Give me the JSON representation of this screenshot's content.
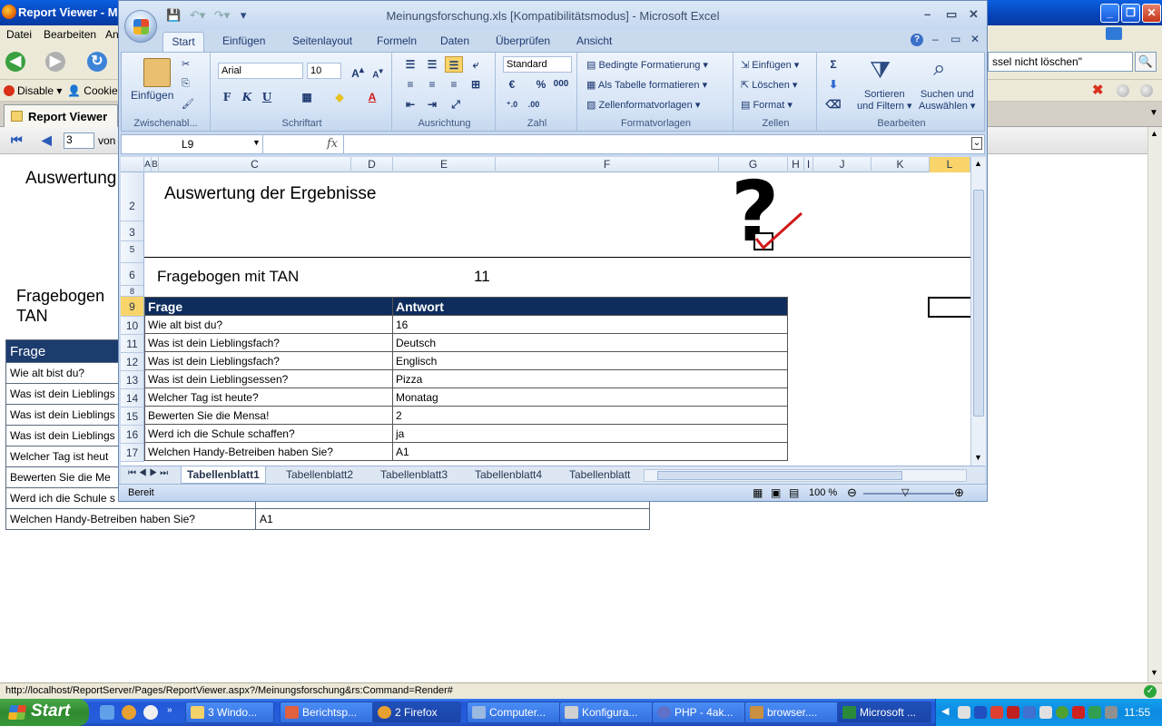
{
  "firefox": {
    "title": "Report Viewer - M",
    "menu": [
      "Datei",
      "Bearbeiten",
      "An"
    ],
    "search_value": "ssel nicht löschen\"",
    "webdev": {
      "disable": "Disable",
      "cookies": "Cookies"
    },
    "tab_label": "Report Viewer",
    "page_number": "3",
    "page_of": "von",
    "status_url": "http://localhost/ReportServer/Pages/ReportViewer.aspx?/Meinungsforschung&rs:Command=Render#"
  },
  "report": {
    "title": "Auswertung",
    "subtitle_line1": "Fragebogen ",
    "subtitle_line2": "TAN",
    "header": "Frage",
    "rows": [
      {
        "q": "Wie alt bist du?",
        "a": ""
      },
      {
        "q": "Was ist dein Lieblings",
        "a": ""
      },
      {
        "q": "Was ist dein Lieblings",
        "a": ""
      },
      {
        "q": "Was ist dein Lieblings",
        "a": ""
      },
      {
        "q": "Welcher Tag ist heut",
        "a": ""
      },
      {
        "q": "Bewerten Sie die Me",
        "a": ""
      },
      {
        "q": "Werd ich die Schule s",
        "a": ""
      },
      {
        "q": "Welchen Handy-Betreiben haben Sie?",
        "a": "A1"
      }
    ]
  },
  "excel": {
    "title": "Meinungsforschung.xls  [Kompatibilitätsmodus] - Microsoft Excel",
    "tabs": [
      "Start",
      "Einfügen",
      "Seitenlayout",
      "Formeln",
      "Daten",
      "Überprüfen",
      "Ansicht"
    ],
    "ribbon": {
      "clipboard": {
        "paste": "Einfügen",
        "label": "Zwischenabl..."
      },
      "font": {
        "name": "Arial",
        "size": "10",
        "label": "Schriftart",
        "bold": "F",
        "italic": "K",
        "underline": "U"
      },
      "alignment": {
        "label": "Ausrichtung"
      },
      "number": {
        "format": "Standard",
        "percent": "%",
        "thousands": "000",
        "label": "Zahl"
      },
      "styles": {
        "conditional": "Bedingte Formatierung",
        "as_table": "Als Tabelle formatieren",
        "cell_styles": "Zellenformatvorlagen",
        "label": "Formatvorlagen"
      },
      "cells": {
        "insert": "Einfügen",
        "delete": "Löschen",
        "format": "Format",
        "label": "Zellen"
      },
      "editing": {
        "sort_line1": "Sortieren",
        "sort_line2": "und Filtern",
        "find_line1": "Suchen und",
        "find_line2": "Auswählen",
        "label": "Bearbeiten",
        "sum": "Σ"
      }
    },
    "name_box": "L9",
    "fx": "fx",
    "columns": [
      "A",
      "B",
      "C",
      "D",
      "E",
      "F",
      "G",
      "H",
      "I",
      "J",
      "K",
      "L"
    ],
    "row_numbers": [
      "2",
      "3",
      "5",
      "6",
      "8",
      "9",
      "10",
      "11",
      "12",
      "13",
      "14",
      "15",
      "16",
      "17"
    ],
    "heading": "Auswertung der Ergebnisse",
    "form_label": "Fragebogen mit TAN",
    "form_value": "11",
    "table_header": {
      "q": "Frage",
      "a": "Antwort"
    },
    "table_rows": [
      {
        "q": "Wie alt bist du?",
        "a": "16"
      },
      {
        "q": "Was ist dein Lieblingsfach?",
        "a": "Deutsch"
      },
      {
        "q": "Was ist dein Lieblingsfach?",
        "a": "Englisch"
      },
      {
        "q": "Was ist dein Lieblingsessen?",
        "a": "Pizza"
      },
      {
        "q": "Welcher Tag ist heute?",
        "a": "Monatag"
      },
      {
        "q": "Bewerten Sie die Mensa!",
        "a": " 2"
      },
      {
        "q": "Werd ich die Schule schaffen?",
        "a": "ja"
      },
      {
        "q": "Welchen Handy-Betreiben haben Sie?",
        "a": "A1"
      }
    ],
    "sheets": [
      "Tabellenblatt1",
      "Tabellenblatt2",
      "Tabellenblatt3",
      "Tabellenblatt4",
      "Tabellenblatt"
    ],
    "status": "Bereit",
    "zoom": "100 %"
  },
  "taskbar": {
    "start": "Start",
    "tasks": [
      "3 Windo...",
      "Berichtsp...",
      "2 Firefox",
      "Computer...",
      "Konfigura...",
      "PHP - 4ak...",
      "browser....",
      "Microsoft ..."
    ],
    "clock": "11:55"
  }
}
